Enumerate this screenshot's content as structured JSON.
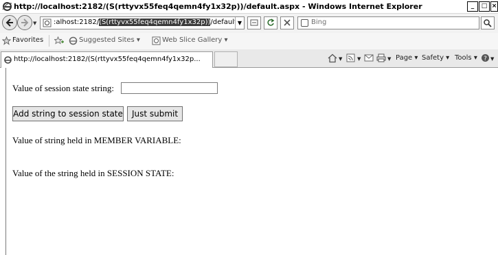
{
  "window": {
    "title": "http://localhost:2182/(S(rttyvx55feq4qemn4fy1x32p))/default.aspx - Windows Internet Explorer"
  },
  "address": {
    "prefix": ":alhost:2182/",
    "selected": "(S(rttyvx55feq4qemn4fy1x32p))",
    "suffix": "/default.aspx"
  },
  "search": {
    "placeholder": "Bing"
  },
  "favorites_bar": {
    "favorites_label": "Favorites",
    "suggested_sites": "Suggested Sites ▾",
    "web_slice_gallery": "Web Slice Gallery ▾"
  },
  "tab": {
    "title": "http://localhost:2182/(S(rttyvx55feq4qemn4fy1x32p..."
  },
  "command_bar": {
    "page": "Page ▾",
    "safety": "Safety ▾",
    "tools": "Tools ▾"
  },
  "page": {
    "session_input_label": "Value of session state string:",
    "session_input_value": "",
    "add_button": "Add string to session state",
    "submit_button": "Just submit",
    "member_variable_label": "Value of string held in MEMBER VARIABLE:",
    "session_state_label": "Value of the string held in SESSION STATE:"
  },
  "colors": {
    "selection": "#3a3a3a",
    "button_face": "#e6e6e6"
  }
}
